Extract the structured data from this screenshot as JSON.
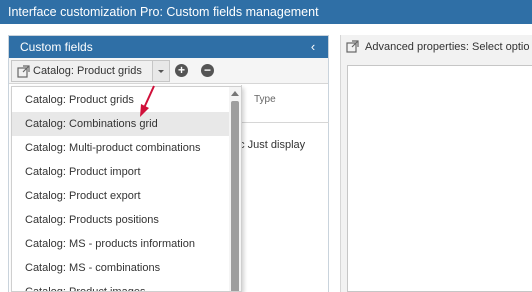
{
  "window": {
    "title": "Interface customization Pro: Custom fields management"
  },
  "custom_fields_panel": {
    "title": "Custom fields",
    "collapse_icon": "chevron-left-icon",
    "selector": {
      "value": "Catalog: Product grids",
      "icon": "external-link-icon"
    },
    "add_icon": "plus-circle-icon",
    "remove_icon": "minus-circle-icon",
    "grid": {
      "column_type": "Type",
      "row_partial": "nc Just display"
    },
    "dropdown": {
      "options": [
        "Catalog: Product grids",
        "Catalog: Combinations grid",
        "Catalog: Multi-product combinations",
        "Catalog: Product import",
        "Catalog: Product export",
        "Catalog: Products positions",
        "Catalog: MS - products information",
        "Catalog: MS - combinations",
        "Catalog: Product images"
      ],
      "highlighted_index": 1
    }
  },
  "advanced_panel": {
    "title": "Advanced properties: Select optio",
    "icon": "external-link-icon"
  },
  "colors": {
    "accent": "#2f6fa6",
    "annotation_arrow": "#d0103a"
  }
}
